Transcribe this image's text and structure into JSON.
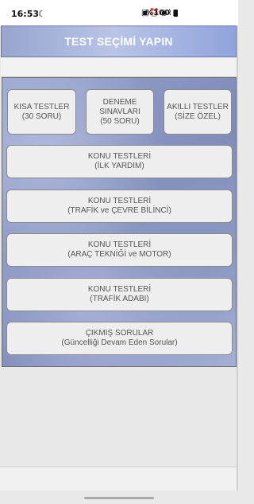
{
  "status_bar": {
    "time": "16:53",
    "icons": [
      {
        "name": "moon-icon",
        "glyph": "☾"
      },
      {
        "name": "sim-icon",
        "glyph": "▣"
      },
      {
        "name": "alarm-icon",
        "glyph": "⏰"
      },
      {
        "name": "hotspot-icon",
        "glyph": "◉"
      },
      {
        "name": "wifi-icon",
        "glyph": "⌇"
      },
      {
        "name": "signal-icon",
        "glyph": "▮"
      },
      {
        "name": "battery-icon",
        "glyph": "▮"
      }
    ],
    "battery_percent": "%100"
  },
  "title_bar": {
    "title": "TEST SEÇİMİ YAPIN",
    "colors": {
      "start": "#97a5cf",
      "end": "#8fa3dd",
      "text": "#ffffff"
    }
  },
  "buttons": {
    "short_tests": {
      "line1": "KISA TESTLER",
      "line2": "(30 SORU)"
    },
    "mock_exams": {
      "line1": "DENEME",
      "line2": "SINAVLARI",
      "line3": "(50 SORU)"
    },
    "smart_tests": {
      "line1": "AKILLI TESTLER",
      "line2": "(SİZE ÖZEL)"
    },
    "topic_first_aid": {
      "line1": "KONU TESTLERİ",
      "line2": "(İLK YARDIM)"
    },
    "topic_traffic_env": {
      "line1": "KONU TESTLERİ",
      "line2": "(TRAFİK ve ÇEVRE BİLİNCİ)"
    },
    "topic_vehicle_motor": {
      "line1": "KONU TESTLERİ",
      "line2": "(ARAÇ TEKNİĞİ ve MOTOR)"
    },
    "topic_traffic_etiquette": {
      "line1": "KONU TESTLERİ",
      "line2": "(TRAFİK ADABI)"
    },
    "past_questions": {
      "line1": "ÇIKMIŞ SORULAR",
      "line2": "(Güncelliği Devam Eden Sorular)"
    }
  },
  "colors": {
    "panel": "#8f9ac7",
    "button_bg": "#eeeeee",
    "button_text": "#555555"
  }
}
